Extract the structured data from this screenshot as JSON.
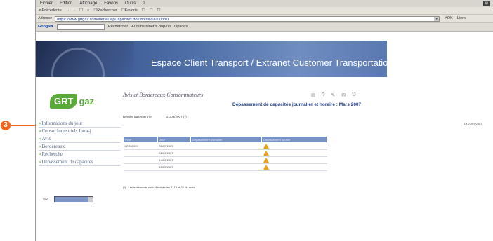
{
  "browser": {
    "menu": [
      "Fichier",
      "Edition",
      "Affichage",
      "Favoris",
      "Outils",
      "?"
    ],
    "toolbar": [
      "⇐Précédente",
      "→",
      "·",
      "☐",
      "⌂",
      "☐Rechercher",
      "☐Favoris",
      "☐",
      "☐",
      "☐"
    ],
    "address_label": "Adresse",
    "address_value": "https://www.grtgaz.com/alerteDepCapacites.do?mois=2007/03/01",
    "go_label": "⇗OK",
    "links_label": "Liens",
    "google_label": "Google▾",
    "search_label": "Rechercher",
    "popup_label": "Aucune fenêtre pop-up",
    "options_label": "Options"
  },
  "banner": {
    "title": "Espace Client Transport / Extranet Customer Transportation"
  },
  "logo": {
    "part1": "GRT",
    "part2": "gaz"
  },
  "subtitle": "Avis et Bordereaux Consommateurs",
  "page_heading": "Dépassement de capacités journalier et horaire : Mars 2007",
  "traitement": {
    "label": "Dernier traitement le",
    "value": "21/03/2007 (*)"
  },
  "date_right": "Le 27/03/2007",
  "sidebar": {
    "items": [
      "Informations du jour",
      "Conso. Industriels Intra-j",
      "Avis",
      "Bordereaux",
      "Recherche",
      "Dépassement de capacités"
    ]
  },
  "table": {
    "headers": [
      "Point",
      "Jour",
      "Dépassement journalier",
      "Dépassement horaire"
    ],
    "rows": [
      {
        "point": "LCR00999",
        "jour": "01/03/2007"
      },
      {
        "point": "",
        "jour": "06/03/2007"
      },
      {
        "point": "",
        "jour": "14/03/2007"
      },
      {
        "point": "",
        "jour": "20/03/2007"
      }
    ]
  },
  "footnote": "(*) : Les traitements sont effectués les 5, 15 et 21 du mois",
  "site": {
    "label": "Site",
    "value": ""
  },
  "callout": "3",
  "icons": [
    "print-icon",
    "help-icon",
    "edit-icon",
    "email-icon",
    "logout-icon"
  ]
}
